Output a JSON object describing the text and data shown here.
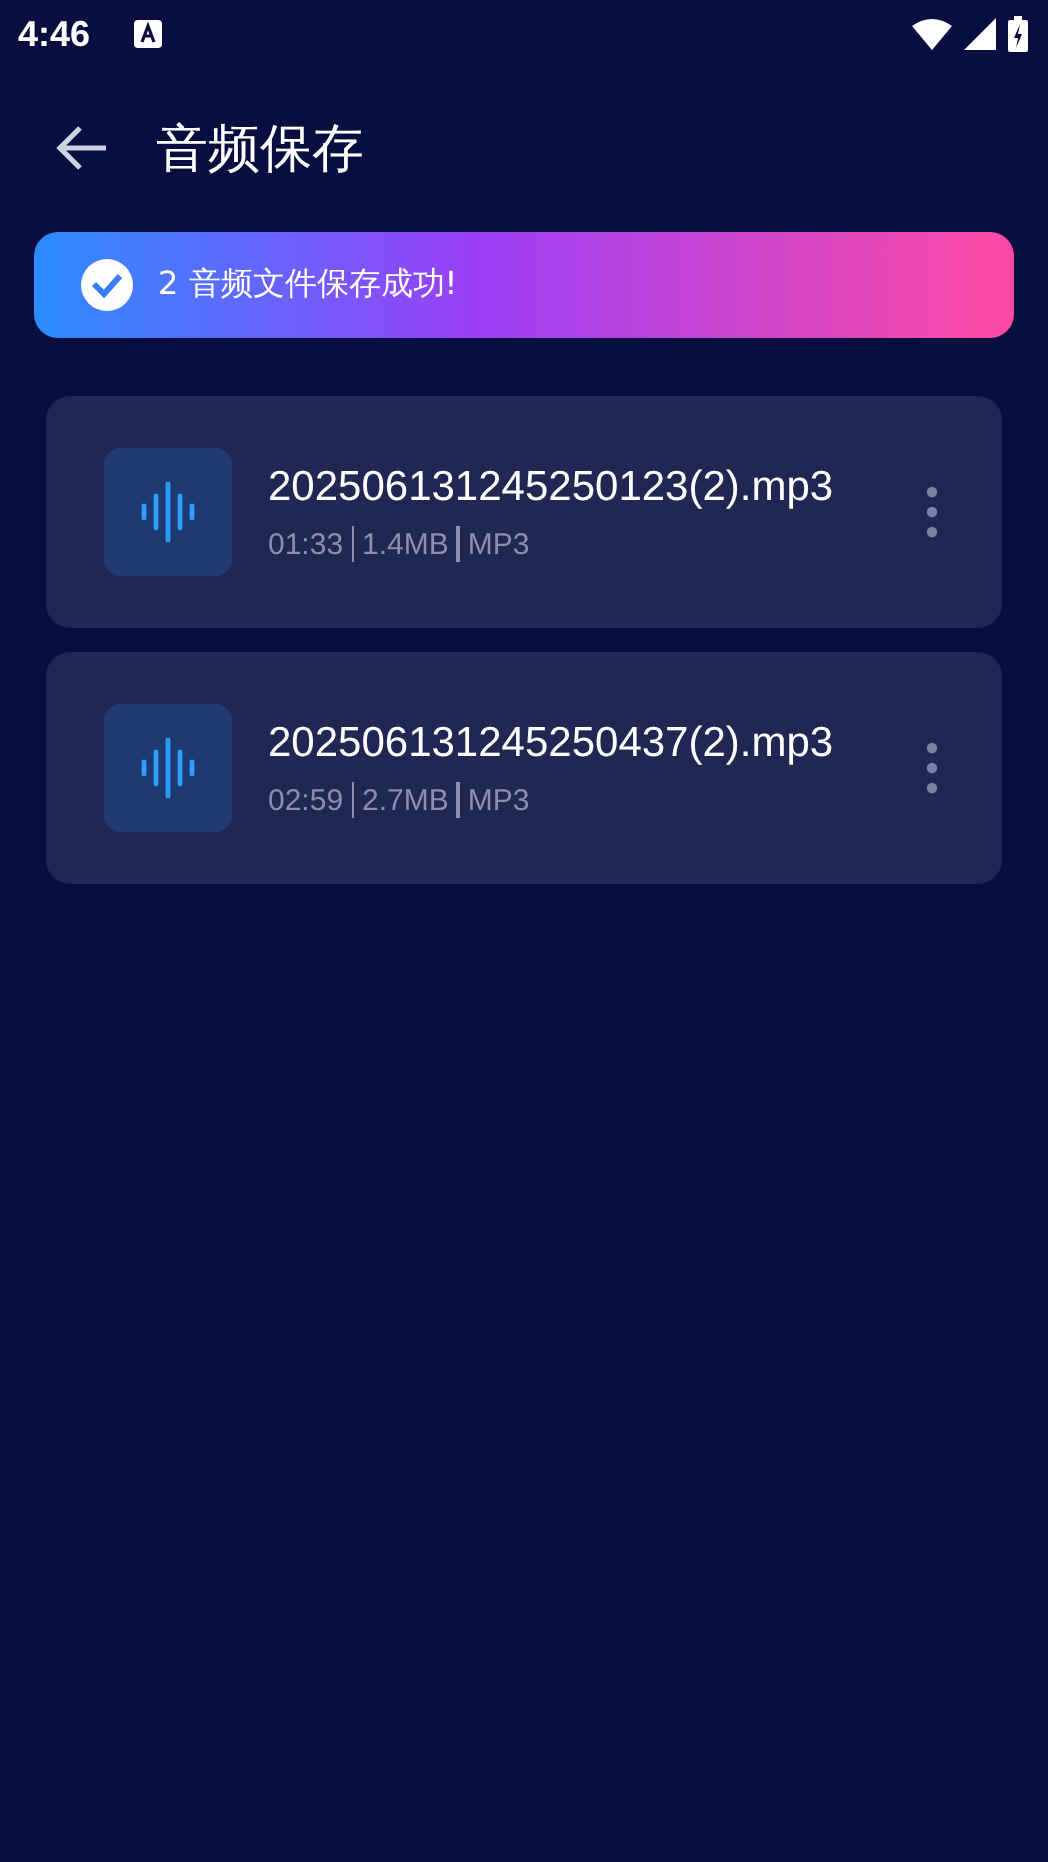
{
  "status_bar": {
    "time": "4:46"
  },
  "header": {
    "title": "音频保存"
  },
  "banner": {
    "message": "2 音频文件保存成功!"
  },
  "files": [
    {
      "name": "202506131245250123(2).mp3",
      "duration": "01:33",
      "size": "1.4MB",
      "format": "MP3"
    },
    {
      "name": "202506131245250437(2).mp3",
      "duration": "02:59",
      "size": "2.7MB",
      "format": "MP3"
    }
  ]
}
